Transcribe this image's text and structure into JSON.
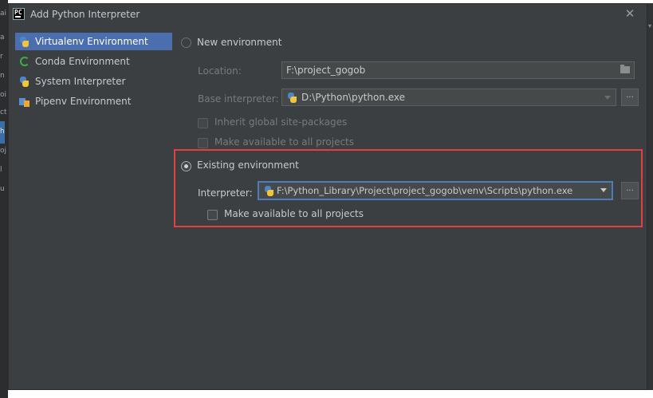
{
  "dialog": {
    "app_icon_text": "PC",
    "title": "Add Python Interpreter",
    "close_symbol": "✕"
  },
  "left_strip": {
    "fragments": [
      "ai",
      "a",
      "r",
      "n",
      "oi",
      "ct",
      "h",
      "oj",
      "l",
      "u"
    ]
  },
  "sidebar": {
    "items": [
      {
        "label": "Virtualenv Environment",
        "icon": "python-icon",
        "selected": true
      },
      {
        "label": "Conda Environment",
        "icon": "conda-icon",
        "selected": false
      },
      {
        "label": "System Interpreter",
        "icon": "python-icon",
        "selected": false
      },
      {
        "label": "Pipenv Environment",
        "icon": "pipenv-icon",
        "selected": false
      }
    ]
  },
  "new_env": {
    "radio_label": "New environment",
    "selected": false,
    "location_label": "Location:",
    "location_value": "F:\\project_gogob",
    "base_label": "Base interpreter:",
    "base_value": "D:\\Python\\python.exe",
    "browse_label": "...",
    "inherit_label": "Inherit global site-packages",
    "available_label": "Make available to all projects"
  },
  "existing_env": {
    "radio_label": "Existing environment",
    "selected": true,
    "interpreter_label": "Interpreter:",
    "interpreter_value": "F:\\Python_Library\\Project\\project_gogob\\venv\\Scripts\\python.exe",
    "browse_label": "...",
    "available_label": "Make available to all projects"
  },
  "colors": {
    "dialog_bg": "#3c3f41",
    "selection": "#4b6eaf",
    "annotation_border": "#e0403f",
    "focus_border": "#4b7eb8"
  }
}
